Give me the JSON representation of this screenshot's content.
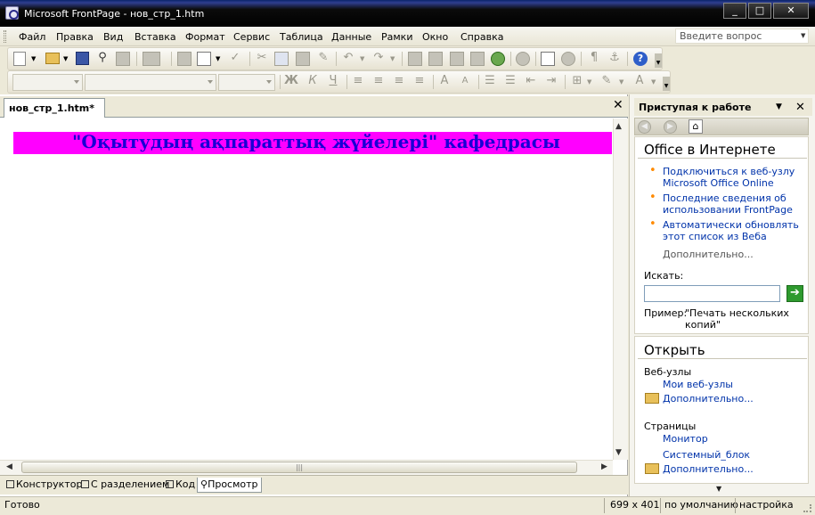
{
  "window": {
    "title": "Microsoft FrontPage - нов_стр_1.htm",
    "min": "_",
    "max": "□",
    "close": "✕"
  },
  "menu": {
    "items": [
      "Файл",
      "Правка",
      "Вид",
      "Вставка",
      "Формат",
      "Сервис",
      "Таблица",
      "Данные",
      "Рамки",
      "Окно",
      "Справка"
    ],
    "ask_placeholder": "Введите вопрос"
  },
  "toolbar": {
    "help_label": "?",
    "format_buttons": [
      "Ж",
      "К",
      "Ч"
    ]
  },
  "document": {
    "tab_title": "нов_стр_1.htm*",
    "close_label": "✕",
    "banner_text": "\"Оқытудың ақпараттық жүйелері\" кафедрасы"
  },
  "view_tabs": [
    "Конструктор",
    "С разделением",
    "Код",
    "Просмотр"
  ],
  "task_pane": {
    "title": "Приступая к работе",
    "office_section": {
      "heading": "Office в Интернете",
      "links": [
        [
          "Подключиться к веб-узлу",
          "Microsoft Office Online"
        ],
        [
          "Последние сведения об",
          "использовании FrontPage"
        ],
        [
          "Автоматически обновлять",
          "этот список из Веба"
        ]
      ],
      "more": "Дополнительно...",
      "search_label": "Искать:",
      "example_label": "Пример:",
      "example_text": [
        "\"Печать нескольких",
        "копий\""
      ]
    },
    "open_section": {
      "heading": "Открыть",
      "websites_label": "Веб-узлы",
      "my_websites": "Мои веб-узлы",
      "more1": "Дополнительно...",
      "pages_label": "Страницы",
      "page1": "Монитор",
      "page2": "Системный_блок",
      "more2": "Дополнительно..."
    }
  },
  "status": {
    "ready": "Готово",
    "size": "699 x 401",
    "mode": "по умолчанию",
    "custom": "настройка"
  }
}
